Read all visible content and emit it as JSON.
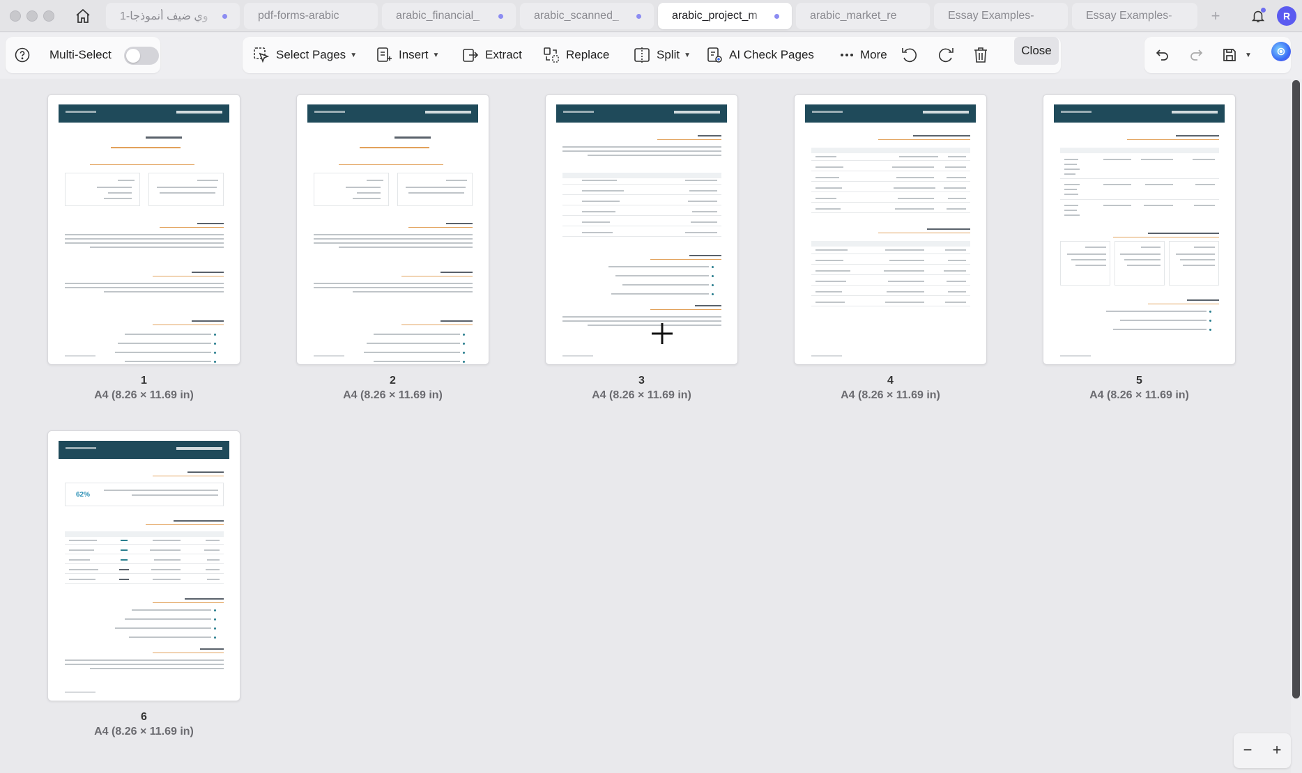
{
  "tabs": [
    {
      "label": "وي ضيف أنموذجا-1",
      "dirty": true,
      "active": false
    },
    {
      "label": "pdf-forms-arabic",
      "dirty": false,
      "active": false
    },
    {
      "label": "arabic_financial_",
      "dirty": true,
      "active": false
    },
    {
      "label": "arabic_scanned_",
      "dirty": true,
      "active": false
    },
    {
      "label": "arabic_project_m",
      "dirty": true,
      "active": true
    },
    {
      "label": "arabic_market_re",
      "dirty": false,
      "active": false
    },
    {
      "label": "Essay Examples-",
      "dirty": false,
      "active": false
    },
    {
      "label": "Essay Examples-",
      "dirty": false,
      "active": false
    }
  ],
  "user": {
    "initial": "R"
  },
  "toolbar": {
    "multi_select": "Multi-Select",
    "multi_select_on": false,
    "select_pages": "Select Pages",
    "insert": "Insert",
    "extract": "Extract",
    "replace": "Replace",
    "split": "Split",
    "ai_check": "AI Check Pages",
    "more": "More",
    "close": "Close"
  },
  "pages": [
    {
      "number": "1",
      "size": "A4 (8.26 × 11.69 in)"
    },
    {
      "number": "2",
      "size": "A4 (8.26 × 11.69 in)"
    },
    {
      "number": "3",
      "size": "A4 (8.26 × 11.69 in)"
    },
    {
      "number": "4",
      "size": "A4 (8.26 × 11.69 in)"
    },
    {
      "number": "5",
      "size": "A4 (8.26 × 11.69 in)"
    },
    {
      "number": "6",
      "size": "A4 (8.26 × 11.69 in)"
    }
  ],
  "thumb_text": {
    "percent": "62%"
  },
  "zoom": {
    "minus": "−",
    "plus": "+"
  },
  "colors": {
    "accent": "#5a5af0",
    "doc_header": "#1f4a5a",
    "doc_accent": "#e2a15a",
    "doc_teal": "#2a7f8f"
  }
}
